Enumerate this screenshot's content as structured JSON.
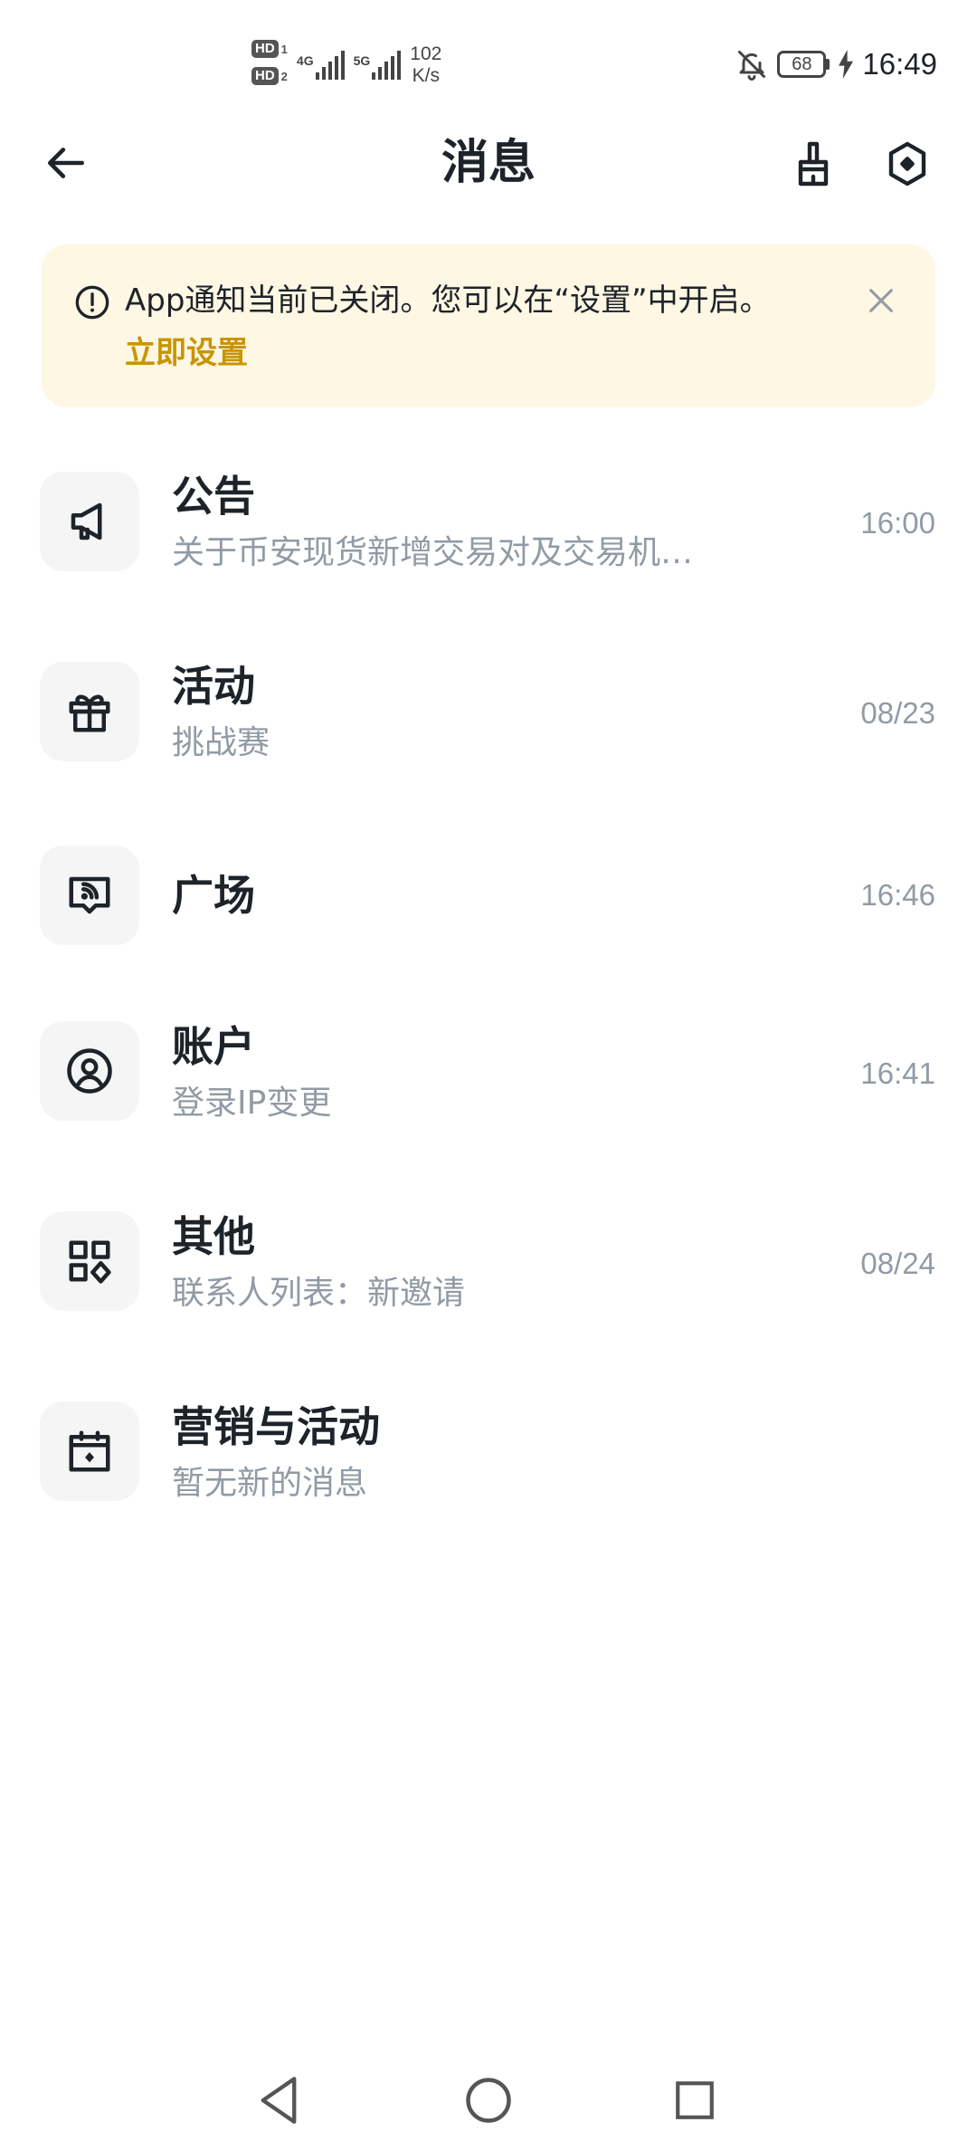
{
  "status_bar": {
    "sim1": "HD",
    "sim1_index": "1",
    "sim2": "HD",
    "sim2_index": "2",
    "network1": "4G",
    "network2": "5G",
    "speed_value": "102",
    "speed_unit": "K/s",
    "battery": "68",
    "time": "16:49"
  },
  "header": {
    "title": "消息",
    "back_icon": "arrow-left-icon",
    "clear_icon": "brush-icon",
    "settings_icon": "hexagon-settings-icon"
  },
  "notice": {
    "text": "App通知当前已关闭。您可以在“设置”中开启。",
    "link": "立即设置",
    "accent_color": "#c99400",
    "background": "#fdf7e4"
  },
  "messages": [
    {
      "icon": "megaphone-icon",
      "title": "公告",
      "subtitle": "关于币安现货新增交易对及交易机…",
      "time": "16:00"
    },
    {
      "icon": "gift-icon",
      "title": "活动",
      "subtitle": "挑战赛",
      "time": "08/23"
    },
    {
      "icon": "chat-feed-icon",
      "title": "广场",
      "subtitle": "",
      "time": "16:46"
    },
    {
      "icon": "user-circle-icon",
      "title": "账户",
      "subtitle": "登录IP变更",
      "time": "16:41"
    },
    {
      "icon": "apps-grid-icon",
      "title": "其他",
      "subtitle": "联系人列表：新邀请",
      "time": "08/24"
    },
    {
      "icon": "calendar-icon",
      "title": "营销与活动",
      "subtitle": "暂无新的消息",
      "time": ""
    }
  ],
  "nav_bar": {
    "back": "triangle-back-icon",
    "home": "circle-home-icon",
    "recents": "square-recents-icon"
  }
}
